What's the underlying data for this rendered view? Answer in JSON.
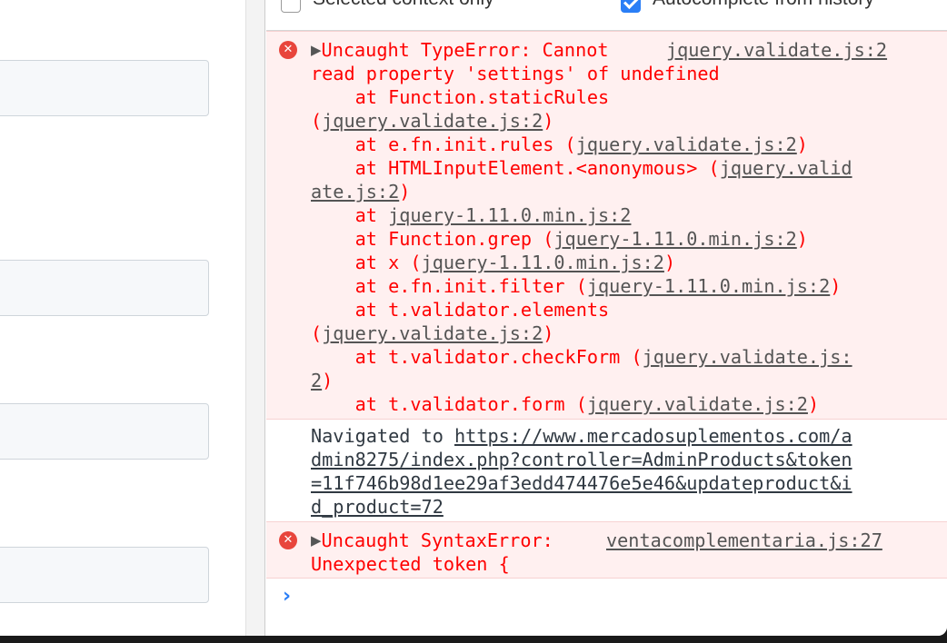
{
  "settings": {
    "selected_context_label": "Selected context only",
    "selected_context_checked": false,
    "autocomplete_label": "Autocomplete from history",
    "autocomplete_checked": true
  },
  "icons": {
    "error": "error-x-icon",
    "expand": "expand-triangle-icon",
    "prompt": "prompt-chevron-icon"
  },
  "colors": {
    "error_text": "#ff0000",
    "error_bg": "#fff0f0",
    "error_icon": "#e8453c",
    "accent": "#2a7ef6"
  },
  "messages": [
    {
      "type": "error",
      "expand_glyph": "▶",
      "title_1": "Uncaught TypeError: Cannot",
      "title_2": "read property 'settings' of undefined",
      "source": "jquery.validate.js:2",
      "stack": [
        {
          "prefix": "    at Function.staticRules",
          "link": "",
          "suffix": ""
        },
        {
          "prefix": "(",
          "link": "jquery.validate.js:2",
          "suffix": ")"
        },
        {
          "prefix": "    at e.fn.init.rules (",
          "link": "jquery.validate.js:2",
          "suffix": ")"
        },
        {
          "prefix": "    at HTMLInputElement.<anonymous> (",
          "link": "jquery.valid",
          "suffix": ""
        },
        {
          "prefix": "",
          "link": "ate.js:2",
          "suffix": ")"
        },
        {
          "prefix": "    at ",
          "link": "jquery-1.11.0.min.js:2",
          "suffix": ""
        },
        {
          "prefix": "    at Function.grep (",
          "link": "jquery-1.11.0.min.js:2",
          "suffix": ")"
        },
        {
          "prefix": "    at x (",
          "link": "jquery-1.11.0.min.js:2",
          "suffix": ")"
        },
        {
          "prefix": "    at e.fn.init.filter (",
          "link": "jquery-1.11.0.min.js:2",
          "suffix": ")"
        },
        {
          "prefix": "    at t.validator.elements",
          "link": "",
          "suffix": ""
        },
        {
          "prefix": "(",
          "link": "jquery.validate.js:2",
          "suffix": ")"
        },
        {
          "prefix": "    at t.validator.checkForm (",
          "link": "jquery.validate.js:",
          "suffix": ""
        },
        {
          "prefix": "",
          "link": "2",
          "suffix": ")"
        },
        {
          "prefix": "    at t.validator.form (",
          "link": "jquery.validate.js:2",
          "suffix": ")"
        }
      ]
    },
    {
      "type": "info",
      "prefix": "Navigated to ",
      "url_lines": [
        "https://www.mercadosuplementos.com/a",
        "dmin8275/index.php?controller=AdminProducts&token",
        "=11f746b98d1ee29af3edd474476e5e46&updateproduct&i",
        "d_product=72"
      ]
    },
    {
      "type": "error",
      "expand_glyph": "▶",
      "title_1": "Uncaught SyntaxError:",
      "title_2": "Unexpected token {",
      "source": "ventacomplementaria.js:27"
    }
  ],
  "prompt": {
    "glyph": "›"
  }
}
